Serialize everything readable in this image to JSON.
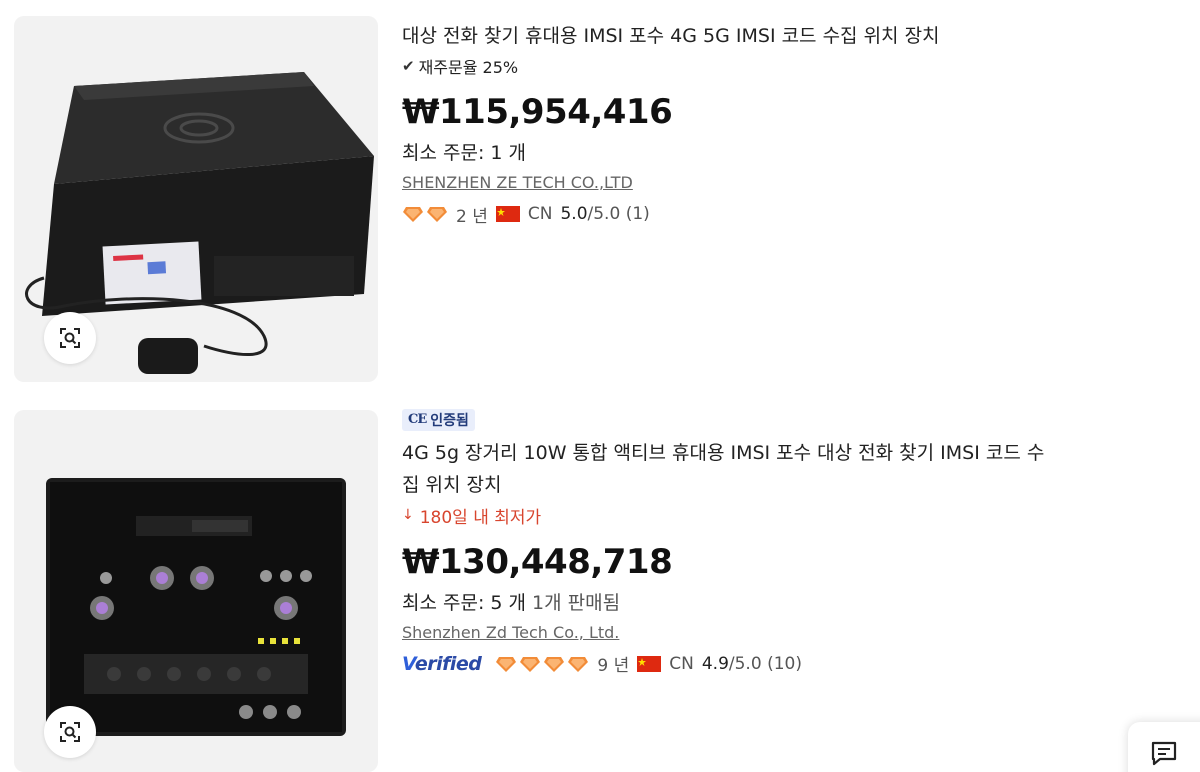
{
  "products": [
    {
      "title": "대상 전화 찾기 휴대용 IMSI 포수 4G 5G IMSI 코드 수집 위치 장치",
      "reorder_rate": "재주문율 25%",
      "price": "₩115,954,416",
      "min_order": "최소 주문: 1 개",
      "supplier": "SHENZHEN ZE TECH CO.,LTD",
      "years": "2 년",
      "country": "CN",
      "rating_score": "5.0",
      "rating_max": "/5.0",
      "review_count": "(1)",
      "diamond_count": 2,
      "icons": [
        "image-search-icon",
        "check-icon",
        "diamond-icon",
        "china-flag-icon"
      ]
    },
    {
      "badge": "인증됨",
      "badge_mark": "CE",
      "title_line1": "4G 5g 장거리 10W 통합 액티브 휴대용 IMSI 포수 대상 전화 찾기 IMSI 코드 수",
      "title_line2": "집 위치 장치",
      "lowest_price": "180일 내 최저가",
      "price": "₩130,448,718",
      "min_order": "최소 주문: 5 개",
      "sold": "1개 판매됨",
      "supplier": "Shenzhen Zd Tech Co., Ltd.",
      "verified_label": "erified",
      "verified_v": "V",
      "years": "9 년",
      "country": "CN",
      "rating_score": "4.9",
      "rating_max": "/5.0",
      "review_count": "(10)",
      "diamond_count": 4,
      "icons": [
        "image-search-icon",
        "arrow-down-icon",
        "diamond-icon",
        "china-flag-icon"
      ]
    }
  ],
  "chat": {
    "icon": "chat-icon"
  },
  "colors": {
    "accent_red": "#d8452e",
    "diamond": "#f28c38",
    "verified_blue": "#2b4aa6",
    "badge_bg": "#e9eefb"
  }
}
